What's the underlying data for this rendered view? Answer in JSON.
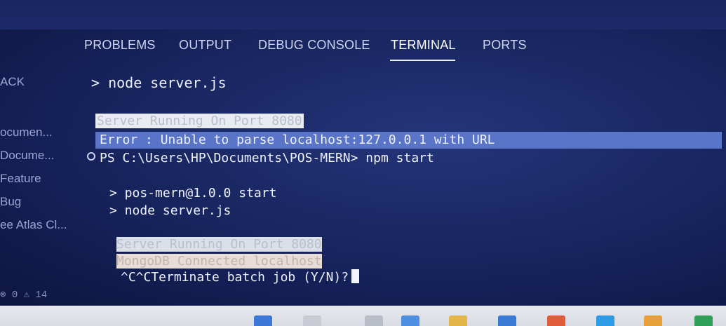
{
  "panel": {
    "tabs": [
      {
        "label": "PROBLEMS"
      },
      {
        "label": "OUTPUT"
      },
      {
        "label": "DEBUG CONSOLE"
      },
      {
        "label": "TERMINAL",
        "active": true
      },
      {
        "label": "PORTS"
      }
    ]
  },
  "sidebar": {
    "items": [
      {
        "label": "ACK"
      },
      {
        "label": "ocumen..."
      },
      {
        "label": "Docume..."
      },
      {
        "label": "Feature"
      },
      {
        "label": "Bug"
      },
      {
        "label": "ee Atlas Cl..."
      }
    ],
    "status": "⊗ 0  ⚠ 14"
  },
  "terminal": {
    "lines": [
      "> node server.js",
      "Server Running On Port 8080",
      "Error : Unable to parse localhost:127.0.0.1 with URL",
      "PS C:\\Users\\HP\\Documents\\POS-MERN> npm start",
      "> pos-mern@1.0.0 start",
      "> node server.js",
      "Server Running On Port 8080",
      "MongoDB Connected localhost",
      "^C^CTerminate batch job (Y/N)?"
    ]
  },
  "colors": {
    "terminal_bg": "#1b2a66",
    "error_highlight": "#5a74c7",
    "selection": "#e8ebf2"
  }
}
